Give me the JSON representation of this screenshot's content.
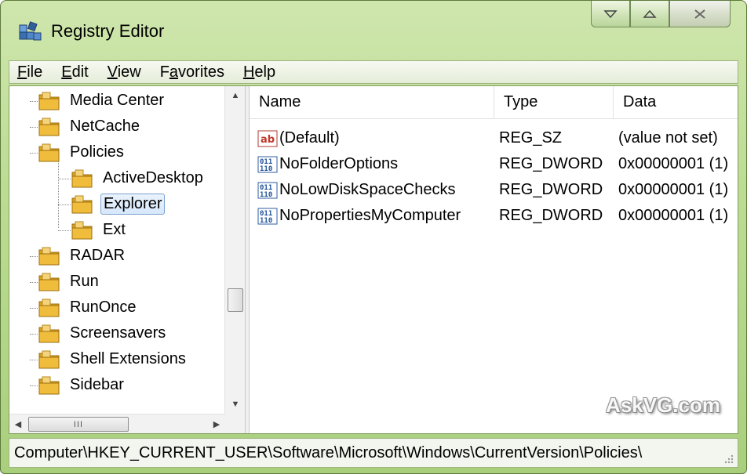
{
  "window": {
    "title": "Registry Editor"
  },
  "menu": [
    {
      "label": "File",
      "hotkey": "F",
      "rest": "ile"
    },
    {
      "label": "Edit",
      "hotkey": "E",
      "rest": "dit"
    },
    {
      "label": "View",
      "hotkey": "V",
      "rest": "iew"
    },
    {
      "label": "Favorites",
      "pre": "F",
      "hotkey": "a",
      "rest": "vorites"
    },
    {
      "label": "Help",
      "hotkey": "H",
      "rest": "elp"
    }
  ],
  "tree": {
    "items": [
      {
        "label": "Media Center",
        "depth": 0
      },
      {
        "label": "NetCache",
        "depth": 0
      },
      {
        "label": "Policies",
        "depth": 0
      },
      {
        "label": "ActiveDesktop",
        "depth": 1
      },
      {
        "label": "Explorer",
        "depth": 1,
        "selected": true
      },
      {
        "label": "Ext",
        "depth": 1
      },
      {
        "label": "RADAR",
        "depth": 0
      },
      {
        "label": "Run",
        "depth": 0
      },
      {
        "label": "RunOnce",
        "depth": 0
      },
      {
        "label": "Screensavers",
        "depth": 0
      },
      {
        "label": "Shell Extensions",
        "depth": 0
      },
      {
        "label": "Sidebar",
        "depth": 0
      }
    ],
    "hscroll_grip": "III"
  },
  "values": {
    "columns": {
      "name": "Name",
      "type": "Type",
      "data": "Data"
    },
    "rows": [
      {
        "name": "(Default)",
        "type": "REG_SZ",
        "data": "(value not set)",
        "icon": "string-value-icon"
      },
      {
        "name": "NoFolderOptions",
        "type": "REG_DWORD",
        "data": "0x00000001 (1)",
        "icon": "binary-value-icon"
      },
      {
        "name": "NoLowDiskSpaceChecks",
        "type": "REG_DWORD",
        "data": "0x00000001 (1)",
        "icon": "binary-value-icon"
      },
      {
        "name": "NoPropertiesMyComputer",
        "type": "REG_DWORD",
        "data": "0x00000001 (1)",
        "icon": "binary-value-icon"
      }
    ]
  },
  "watermark": "AskVG.com",
  "status": {
    "path": "Computer\\HKEY_CURRENT_USER\\Software\\Microsoft\\Windows\\CurrentVersion\\Policies\\"
  },
  "colors": {
    "frame": "#bcdc93",
    "selection": "#d6e7fb",
    "folder": "#e8b43a"
  }
}
